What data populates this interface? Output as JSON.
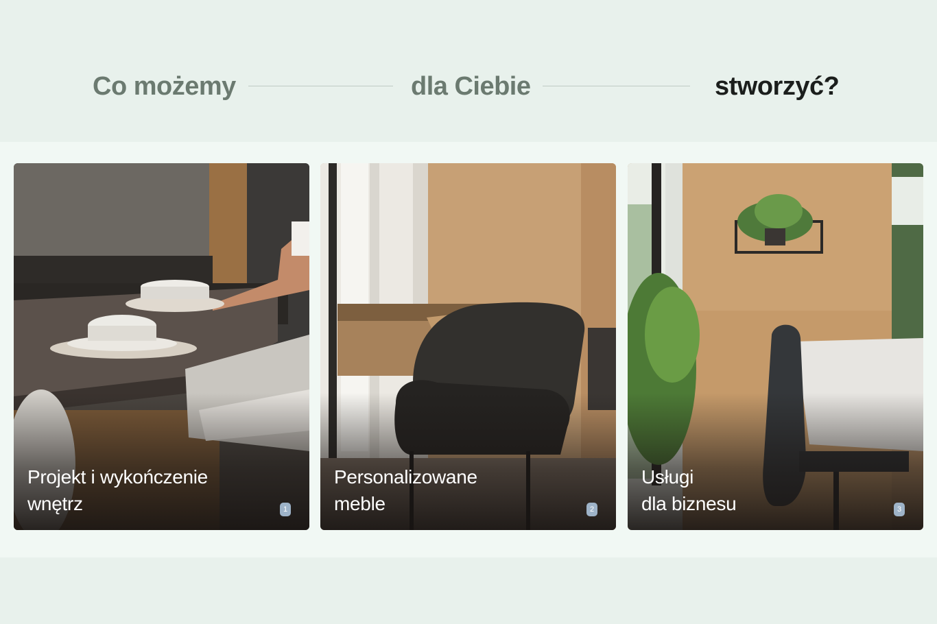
{
  "heading": {
    "part1": "Co możemy",
    "part2": "dla Ciebie",
    "part3": "stworzyć?"
  },
  "cards": [
    {
      "line1": "Projekt i wykończenie",
      "line2": "wnętrz",
      "number": "1",
      "image": "kitchen-counter-photo"
    },
    {
      "line1": "Personalizowane",
      "line2": "meble",
      "number": "2",
      "image": "desk-chair-photo"
    },
    {
      "line1": "Usługi",
      "line2": "dla biznesu",
      "number": "3",
      "image": "office-plant-photo"
    }
  ],
  "colors": {
    "page_background": "#e8f1ec",
    "band_background": "#f1f8f4",
    "heading_muted": "#6b7a70",
    "heading_dark": "#1b1e1c",
    "badge": "#9eb3c8"
  }
}
